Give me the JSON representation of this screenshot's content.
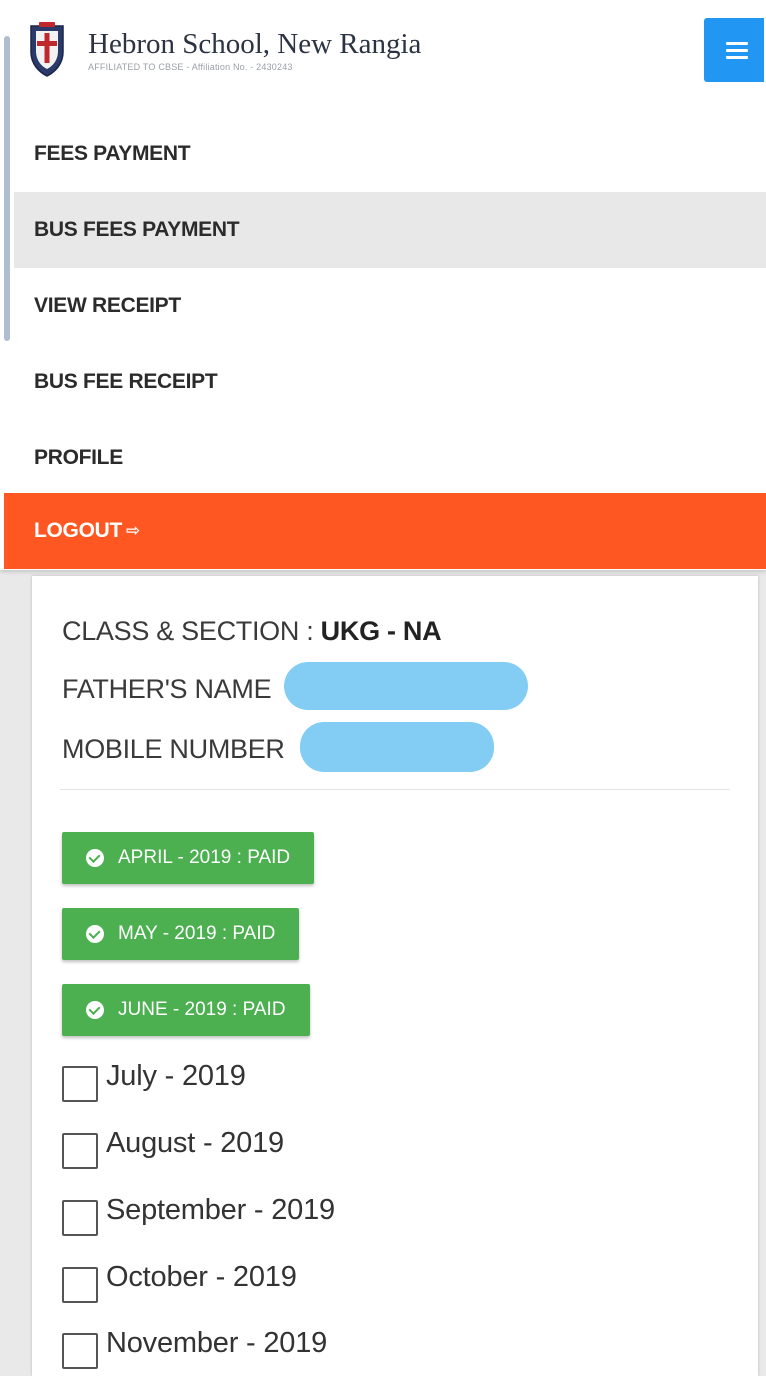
{
  "header": {
    "school_name": "Hebron School, New Rangia",
    "affiliation": "AFFILIATED TO CBSE - Affiliation No. - 2430243",
    "menu_icon": "hamburger-icon"
  },
  "nav": {
    "items": [
      {
        "label": "FEES PAYMENT",
        "active": false
      },
      {
        "label": "BUS FEES PAYMENT",
        "active": true
      },
      {
        "label": "VIEW RECEIPT",
        "active": false
      },
      {
        "label": "BUS FEE RECEIPT",
        "active": false
      },
      {
        "label": "PROFILE",
        "active": false
      }
    ],
    "logout": {
      "label": "LOGOUT",
      "icon": "sign-out-icon",
      "color": "#ff5722"
    }
  },
  "student": {
    "class_label": "CLASS & SECTION : ",
    "class_value": "UKG - NA",
    "father_label": "FATHER'S NAME",
    "mobile_label": "MOBILE NUMBER"
  },
  "paid_months": [
    {
      "label": "APRIL - 2019 : PAID"
    },
    {
      "label": "MAY - 2019 : PAID"
    },
    {
      "label": "JUNE - 2019 : PAID"
    }
  ],
  "unpaid_months": [
    {
      "label": "July - 2019",
      "checked": false
    },
    {
      "label": "August - 2019",
      "checked": false
    },
    {
      "label": "September - 2019",
      "checked": false
    },
    {
      "label": "October - 2019",
      "checked": false
    },
    {
      "label": "November - 2019",
      "checked": false
    }
  ],
  "colors": {
    "menu_button": "#2196f3",
    "paid_badge": "#4caf50",
    "logout": "#ff5722",
    "active_nav": "#e8e8e8"
  }
}
